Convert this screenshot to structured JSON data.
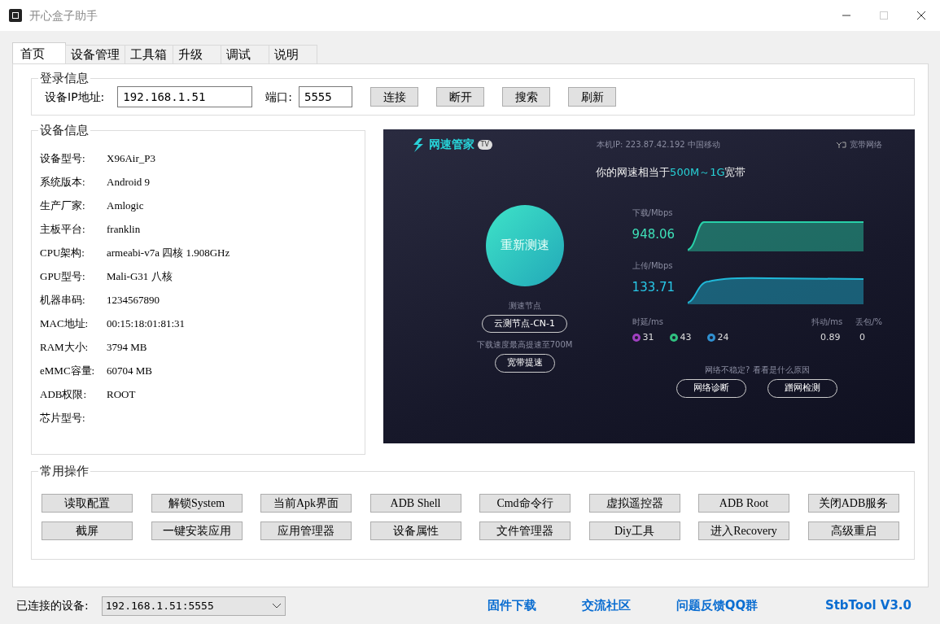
{
  "window": {
    "title": "开心盒子助手"
  },
  "tabs": [
    {
      "label": "首页",
      "selected": true
    },
    {
      "label": "设备管理",
      "selected": false
    },
    {
      "label": "工具箱",
      "selected": false
    },
    {
      "label": "升级",
      "selected": false
    },
    {
      "label": "调试",
      "selected": false
    },
    {
      "label": "说明",
      "selected": false
    }
  ],
  "login": {
    "title": "登录信息",
    "ip_label": "设备IP地址:",
    "ip_value": "192.168.1.51",
    "port_label": "端口:",
    "port_value": "5555",
    "buttons": [
      "连接",
      "断开",
      "搜索",
      "刷新"
    ]
  },
  "device_info": {
    "title": "设备信息",
    "rows": [
      {
        "label": "设备型号:",
        "value": "X96Air_P3"
      },
      {
        "label": "系统版本:",
        "value": "Android 9"
      },
      {
        "label": "生产厂家:",
        "value": "Amlogic"
      },
      {
        "label": "主板平台:",
        "value": "franklin"
      },
      {
        "label": "CPU架构:",
        "value": "armeabi-v7a 四核 1.908GHz"
      },
      {
        "label": "GPU型号:",
        "value": "Mali-G31 八核"
      },
      {
        "label": "机器串码:",
        "value": "1234567890"
      },
      {
        "label": "MAC地址:",
        "value": "00:15:18:01:81:31"
      },
      {
        "label": "RAM大小:",
        "value": "3794 MB"
      },
      {
        "label": "eMMC容量:",
        "value": "60704 MB"
      },
      {
        "label": "ADB权限:",
        "value": "ROOT"
      },
      {
        "label": "芯片型号:"
      }
    ]
  },
  "speedtest": {
    "app_name": "网速管家",
    "badge": "TV",
    "ip_text": "本机IP: 223.87.42.192  中国移动",
    "network": "宽带网络",
    "headline_prefix": "你的网速相当于",
    "headline_highlight": "500M～1G",
    "headline_suffix": "宽带",
    "retest_button": "重新测速",
    "node_label": "测速节点",
    "node_button": "云测节点-CN-1",
    "boost_hint": "下载速度最高提速至700M",
    "boost_button": "宽带提速",
    "download": {
      "label": "下载/Mbps",
      "value": "948.06"
    },
    "upload": {
      "label": "上传/Mbps",
      "value": "133.71"
    },
    "latency_label": "时延/ms",
    "latencies": [
      {
        "value": "31",
        "color": "#a040c0"
      },
      {
        "value": "43",
        "color": "#30c080"
      },
      {
        "value": "24",
        "color": "#3090d0"
      }
    ],
    "jitter_label": "抖动/ms",
    "jitter": "0.89",
    "loss_label": "丢包/%",
    "loss": "0",
    "diag_hint": "网络不稳定? 看看是什么原因",
    "diag_buttons": [
      "网络诊断",
      "蹭网检测"
    ]
  },
  "common_ops": {
    "title": "常用操作",
    "buttons": [
      "读取配置",
      "解锁System",
      "当前Apk界面",
      "ADB Shell",
      "Cmd命令行",
      "虚拟遥控器",
      "ADB  Root",
      "关闭ADB服务",
      "截屏",
      "一键安装应用",
      "应用管理器",
      "设备属性",
      "文件管理器",
      "Diy工具",
      "进入Recovery",
      "高级重启"
    ]
  },
  "status_bar": {
    "device_label": "已连接的设备:",
    "device_value": "192.168.1.51:5555",
    "links": [
      "固件下载",
      "交流社区",
      "问题反馈QQ群"
    ],
    "version": "StbTool V3.0"
  }
}
